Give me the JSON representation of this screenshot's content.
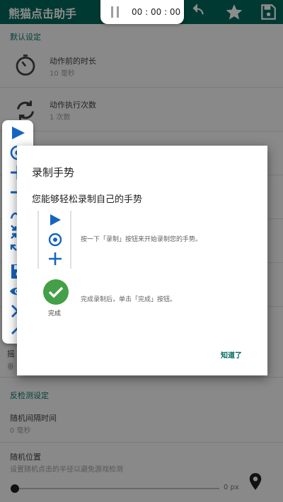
{
  "app": {
    "title": "熊猫点击助手",
    "accent_color": "#00695c",
    "appbar_icons": [
      "undo-icon",
      "star-icon",
      "save-icon"
    ]
  },
  "timer": {
    "value": "00 : 00 : 00",
    "icon": "pause-icon"
  },
  "settings": {
    "default_section": "默认设定",
    "action_delay": {
      "title": "动作前的时长",
      "value": "10 毫秒"
    },
    "action_repeat": {
      "title": "动作执行次数",
      "value": "1 次数"
    },
    "partial_row_char": "摇",
    "partial_row_sub": "垂",
    "anti_detect_section": "反检测设定",
    "random_interval": {
      "title": "随机间隔时间",
      "value": "0 毫秒"
    },
    "random_position": {
      "title": "随机位置",
      "description": "设置随机点击的半径以避免游戏检测"
    },
    "radius_value": "0 px"
  },
  "toolbar": {
    "buttons": [
      "play-icon",
      "target-icon",
      "add-icon",
      "remove-icon",
      "gesture-icon",
      "collapse-icon",
      "expand-icon",
      "save-icon",
      "eye-icon",
      "close-icon",
      "chevron-up-icon"
    ]
  },
  "dialog": {
    "title": "录制手势",
    "message": "您能够轻松录制自己的手势",
    "step1": "按一下「录制」按钮来开始录制您的手势。",
    "done_label": "完成",
    "step2": "完成录制后，单击「完成」按钮。",
    "ok": "知道了",
    "done_color": "#43a047"
  }
}
